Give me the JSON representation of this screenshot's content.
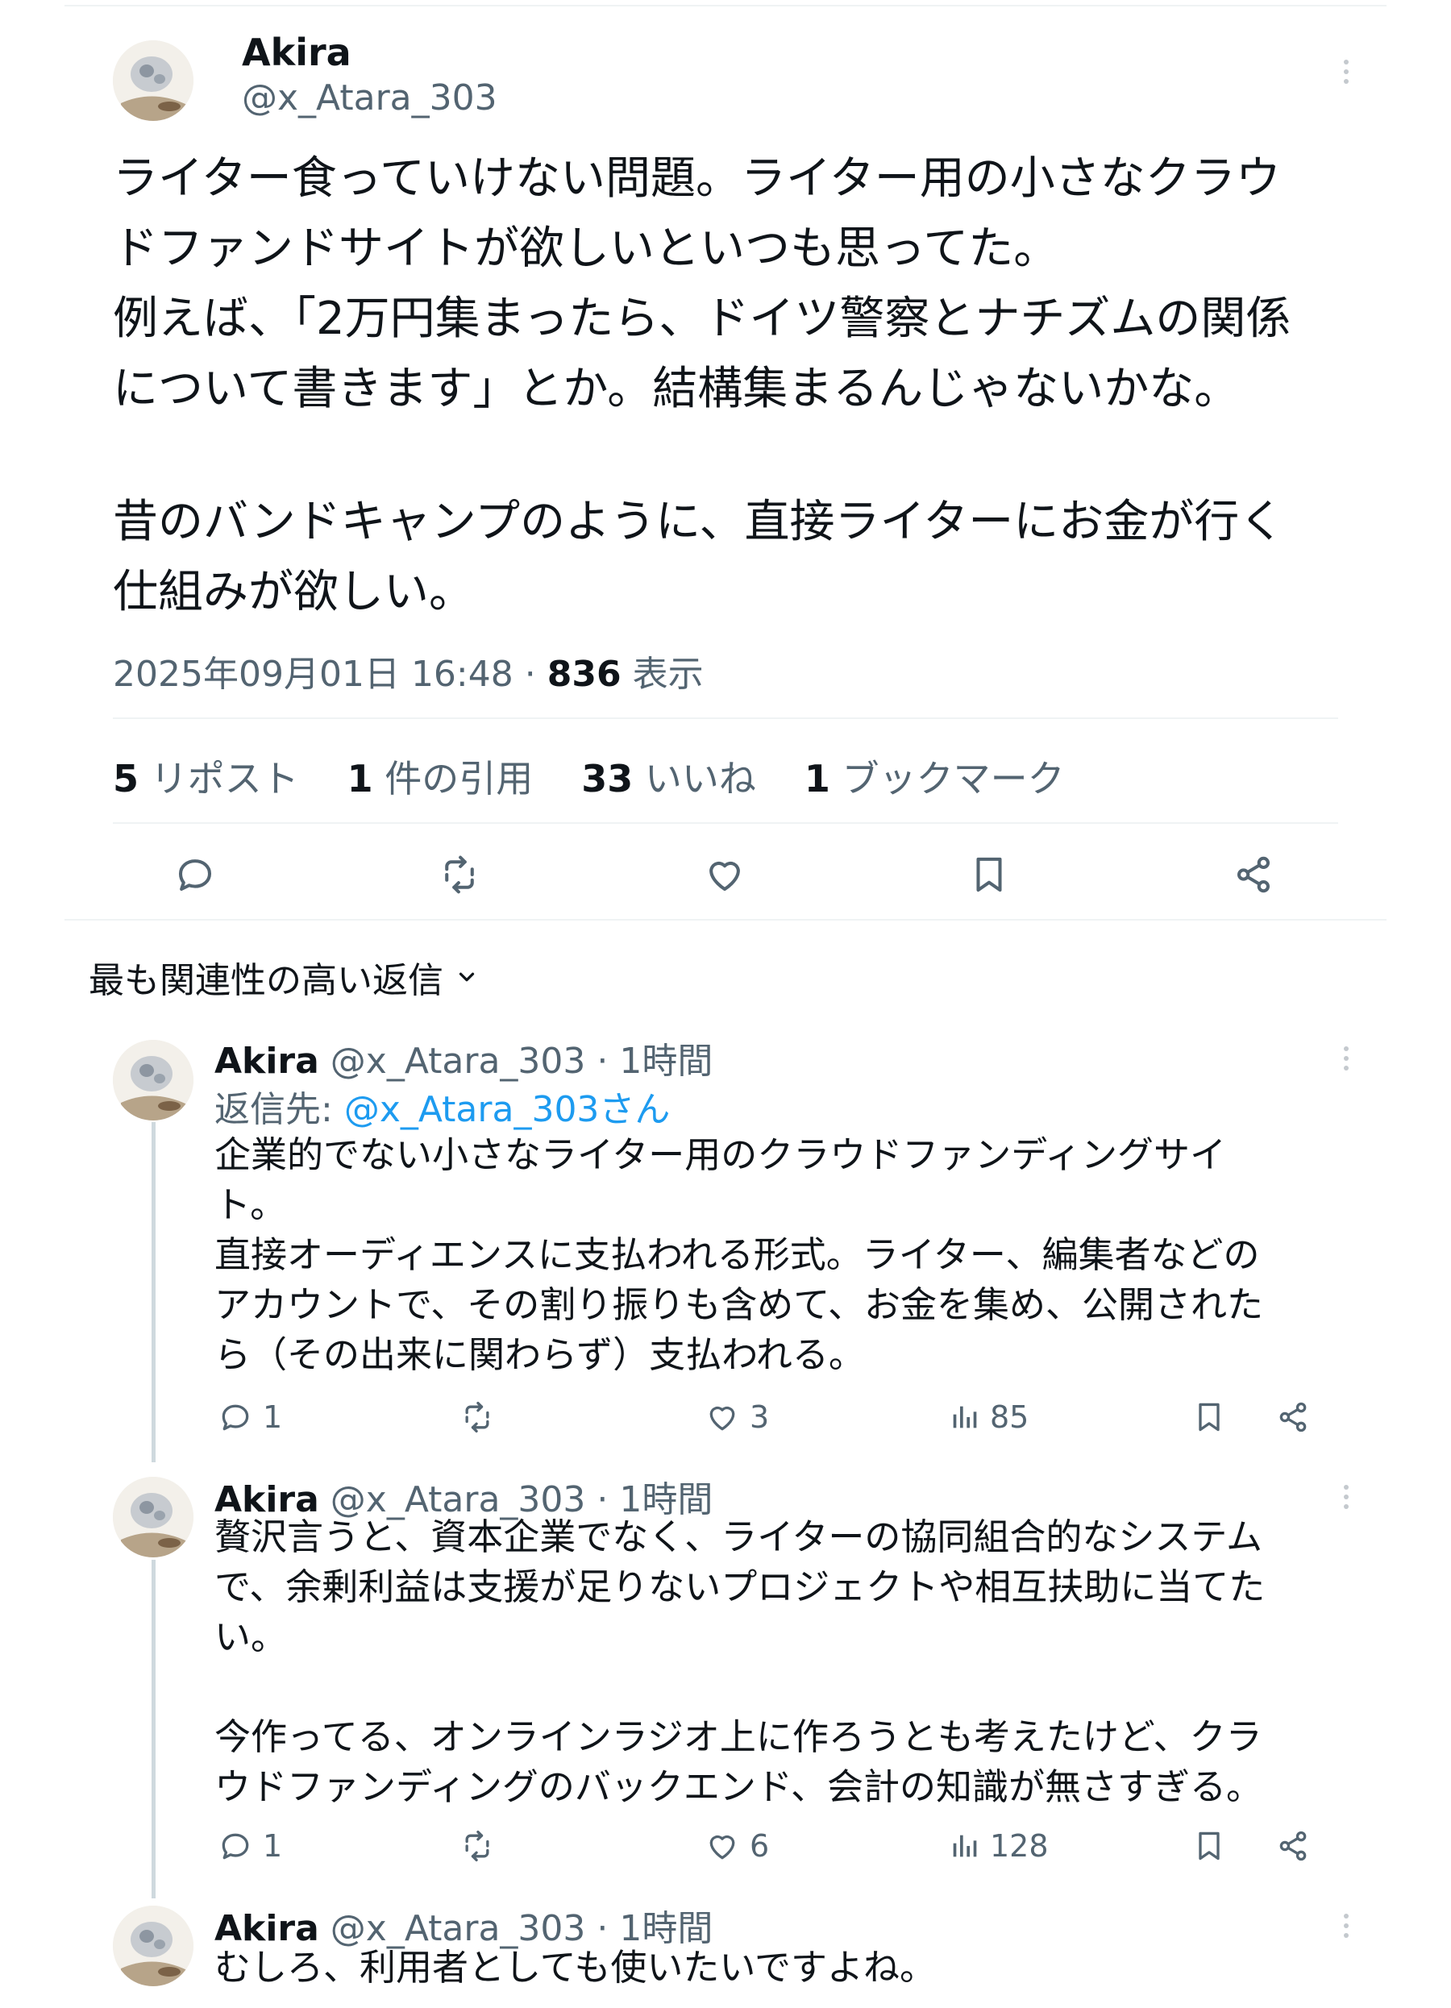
{
  "top_thread_line": "",
  "main_post": {
    "author_name": "Akira",
    "author_handle": "@x_Atara_303",
    "body_lines": [
      "ライター食っていけない問題。ライター用の小さなクラウ",
      "ドファンドサイトが欲しいといつも思ってた。",
      "例えば、「2万円集まったら、ドイツ警察とナチズムの関係",
      "について書きます」とか。結構集まるんじゃないかな。",
      "",
      "昔のバンドキャンプのように、直接ライターにお金が行く",
      "仕組みが欲しい。"
    ],
    "timestamp": "2025年09月01日 16:48",
    "separator": "·",
    "views_count": "836",
    "views_label": "表示",
    "stats": [
      {
        "count": "5",
        "label": "リポスト"
      },
      {
        "count": "1",
        "label": "件の引用"
      },
      {
        "count": "33",
        "label": "いいね"
      },
      {
        "count": "1",
        "label": "ブックマーク"
      }
    ]
  },
  "sort": {
    "label": "最も関連性の高い返信",
    "chevron": "⌄"
  },
  "replies": [
    {
      "author_name": "Akira",
      "author_handle": "@x_Atara_303",
      "time": "· 1時間",
      "reply_to_prefix": "返信先: ",
      "reply_to_handle": "@x_Atara_303さん",
      "body_lines": [
        "企業的でない小さなライター用のクラウドファンディングサイ",
        "ト。",
        "直接オーディエンスに支払われる形式。ライター、編集者などの",
        "アカウントで、その割り振りも含めて、お金を集め、公開された",
        "ら（その出来に関わらず）支払われる。"
      ],
      "reply_count": "1",
      "repost_count": "",
      "like_count": "3",
      "view_count": "85"
    },
    {
      "author_name": "Akira",
      "author_handle": "@x_Atara_303",
      "time": "· 1時間",
      "body_lines": [
        "贅沢言うと、資本企業でなく、ライターの協同組合的なシステム",
        "で、余剰利益は支援が足りないプロジェクトや相互扶助に当てた",
        "い。",
        "",
        "今作ってる、オンラインラジオ上に作ろうとも考えたけど、クラ",
        "ウドファンディングのバックエンド、会計の知識が無さすぎる。"
      ],
      "reply_count": "1",
      "repost_count": "",
      "like_count": "6",
      "view_count": "128"
    },
    {
      "author_name": "Akira",
      "author_handle": "@x_Atara_303",
      "time": "· 1時間",
      "body_lines": [
        "むしろ、利用者としても使いたいですよね。"
      ]
    }
  ],
  "colors": {
    "text": "#0f1419",
    "muted": "#536471",
    "link": "#1d9bf0",
    "divider": "#eff3f4"
  }
}
